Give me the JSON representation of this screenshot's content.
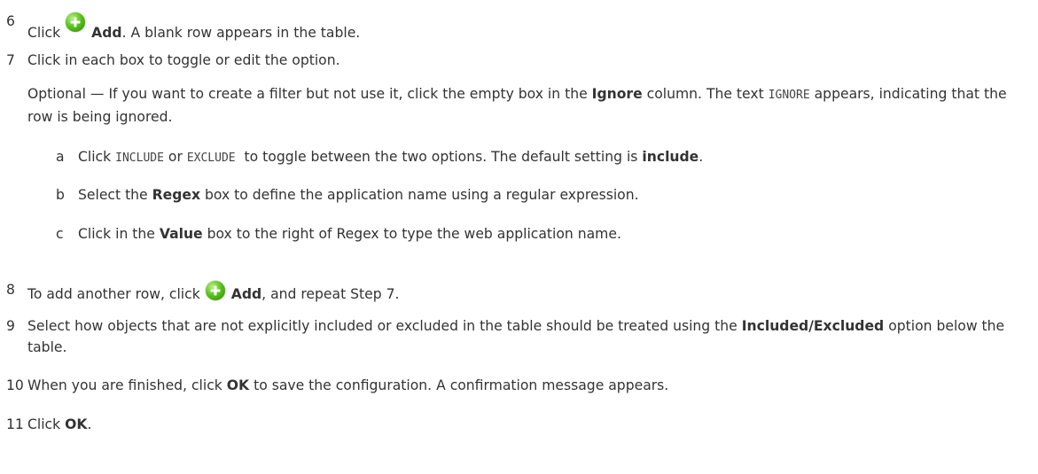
{
  "steps": {
    "s6": {
      "num": "6",
      "click": "Click",
      "add": "Add",
      "rest": ". A blank row appears in the table."
    },
    "s7": {
      "num": "7",
      "text": "Click in each box to toggle or edit the option."
    },
    "optional": {
      "a": "Optional — If you want to create a filter but not use it, click the empty box in the",
      "ignore": "Ignore",
      "b": "column. The text",
      "code": "IGNORE",
      "c": "appears, indicating that the row is being ignored."
    },
    "sa": {
      "letter": "a",
      "click": "Click",
      "include_code": "INCLUDE",
      "or": "or",
      "exclude_code": "EXCLUDE",
      "rest": "to toggle between the two options. The default setting is",
      "default": "include",
      "end": "."
    },
    "sb": {
      "letter": "b",
      "t1": "Select the",
      "regex": "Regex",
      "t2": "box to define the application name using a regular expression."
    },
    "sc": {
      "letter": "c",
      "t1": "Click in the",
      "value": "Value",
      "t2": "box to the right of Regex to type the web application name."
    },
    "s8": {
      "num": "8",
      "t1": "To add another row, click",
      "add": "Add",
      "t2": ", and repeat Step 7."
    },
    "s9": {
      "num": "9",
      "t1": "Select how objects that are not explicitly included or excluded in the table should be treated using the",
      "bold": "Included/Excluded",
      "t2": "option below the table."
    },
    "s10": {
      "num": "10",
      "t1": "When you are finished, click",
      "ok": "OK",
      "t2": "to save the configuration. A confirmation message appears."
    },
    "s11": {
      "num": "11",
      "t1": "Click",
      "ok": "OK",
      "t2": "."
    }
  }
}
